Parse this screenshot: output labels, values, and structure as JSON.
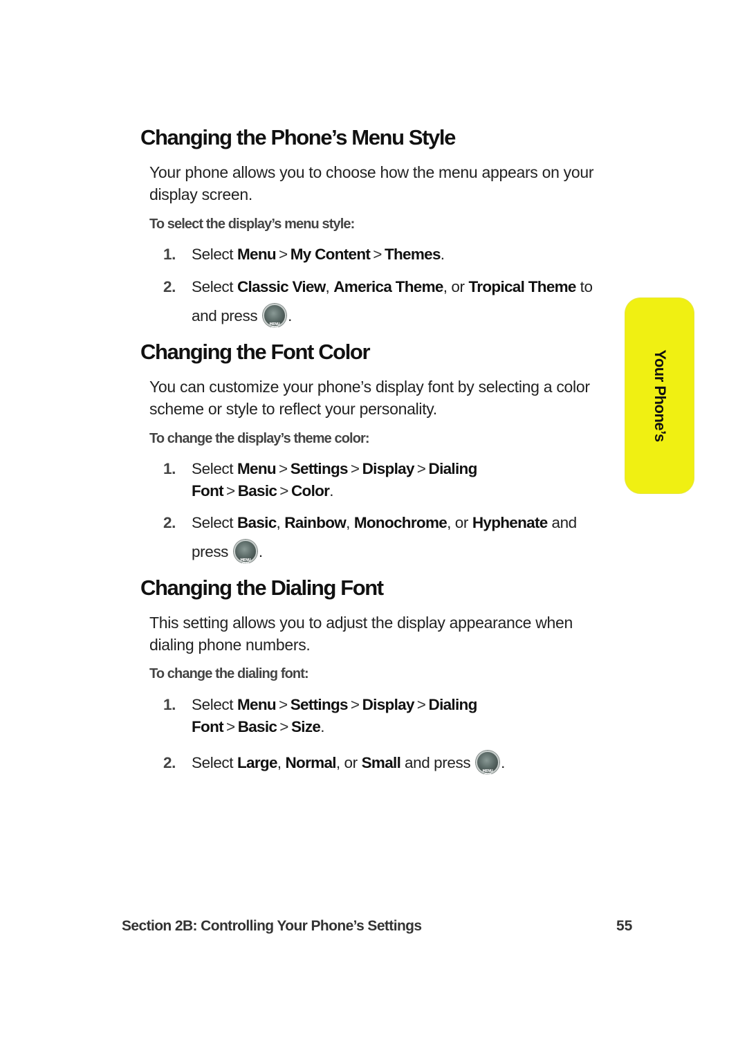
{
  "side_tab": {
    "label": "Your Phone’s",
    "color": "#f0f012"
  },
  "sections": [
    {
      "heading": "Changing the Phone’s Menu Style",
      "intro": "Your phone allows you to choose how the menu appears on your display screen.",
      "subheading": "To select the display’s menu style:",
      "steps": [
        {
          "num": "1.",
          "prefix": "Select",
          "path": [
            "Menu",
            "My Content",
            "Themes"
          ],
          "suffix": "."
        },
        {
          "num": "2.",
          "prefix": "Select",
          "opt1": "Classic View",
          "opt2": "America Theme",
          "conj": "or",
          "opt3": "Tropical Theme",
          "tail": "to and press",
          "end": "."
        }
      ]
    },
    {
      "heading": "Changing the Font Color",
      "intro": "You can customize your phone’s display font by selecting a color scheme or style to reflect your personality.",
      "subheading": "To change the display’s theme color:",
      "steps": [
        {
          "num": "1.",
          "prefix": "Select",
          "path": [
            "Menu",
            "Settings",
            "Display",
            "Dialing Font",
            "Basic",
            "Color"
          ],
          "suffix": "."
        },
        {
          "num": "2.",
          "prefix": "Select",
          "opt1": "Basic",
          "opt2": "Rainbow",
          "opt3": "Monochrome",
          "conj": "or",
          "opt4": "Hyphenate",
          "tail": "and press",
          "end": "."
        }
      ]
    },
    {
      "heading": "Changing the Dialing Font",
      "intro": "This setting allows you to adjust the display appearance when dialing phone numbers.",
      "subheading": "To change the dialing font:",
      "steps": [
        {
          "num": "1.",
          "prefix": "Select",
          "path": [
            "Menu",
            "Settings",
            "Display",
            "Dialing Font",
            "Basic",
            "Size"
          ],
          "suffix": "."
        },
        {
          "num": "2.",
          "prefix": "Select",
          "opt1": "Large",
          "opt2": "Normal",
          "conj": "or",
          "opt3": "Small",
          "tail": "and press",
          "end": "."
        }
      ]
    }
  ],
  "menu_ok_key": {
    "line1": "MENU",
    "line2": "OK",
    "icon": "menu-ok-key-icon"
  },
  "separator": ">",
  "footer": {
    "section_title": "Section 2B: Controlling Your Phone’s Settings",
    "page_number": "55"
  }
}
